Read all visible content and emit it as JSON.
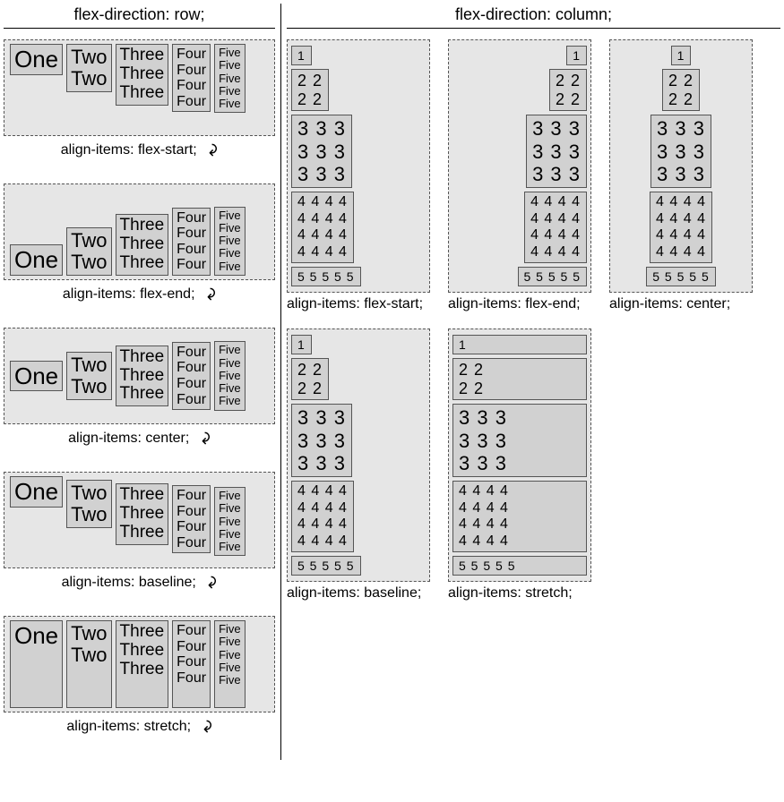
{
  "headers": {
    "row": "flex-direction: row;",
    "column": "flex-direction: column;"
  },
  "row_items": {
    "one": "One",
    "two": "Two\nTwo",
    "three": "Three\nThree\nThree",
    "four": "Four\nFour\nFour\nFour",
    "five": "Five\nFive\nFive\nFive\nFive"
  },
  "row_captions": {
    "start": "align-items: flex-start;",
    "end": "align-items: flex-end;",
    "center": "align-items: center;",
    "baseline": "align-items: baseline;",
    "stretch": "align-items: stretch;"
  },
  "col_items": {
    "c1": "1",
    "c2": "2 2\n2 2",
    "c3": "3 3 3\n3 3 3\n3 3 3",
    "c4": "4 4 4 4\n4 4 4 4\n4 4 4 4\n4 4 4 4",
    "c5": "5 5 5 5 5"
  },
  "col_captions": {
    "start": "align-items: flex-start;",
    "end": "align-items: flex-end;",
    "center": "align-items: center;",
    "baseline": "align-items: baseline;",
    "stretch": "align-items: stretch;"
  },
  "arrow_glyph": "↶"
}
